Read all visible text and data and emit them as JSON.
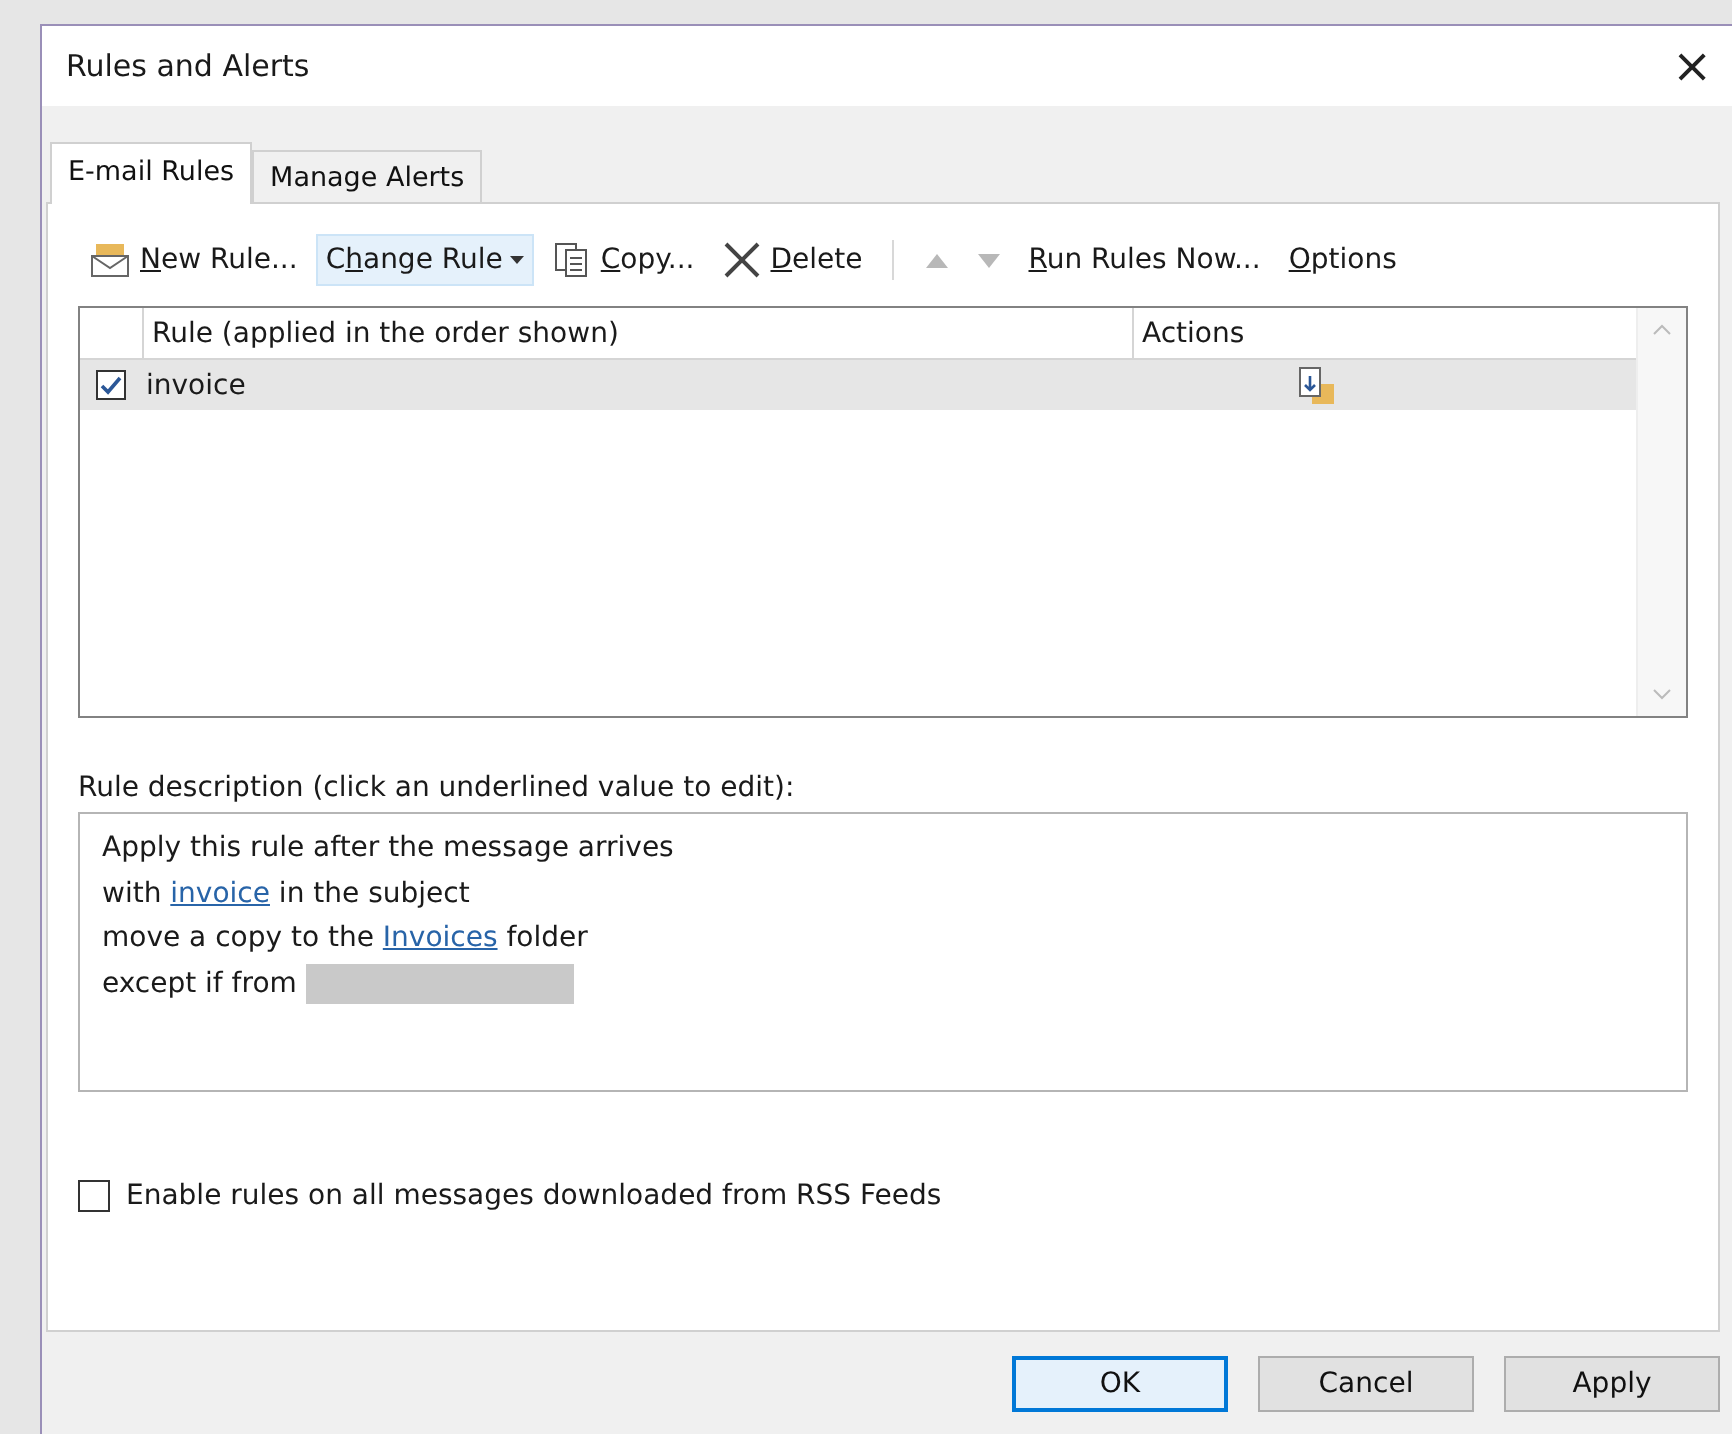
{
  "window": {
    "title": "Rules and Alerts",
    "close": "×"
  },
  "tabs": [
    {
      "label": "E-mail Rules",
      "selected": true
    },
    {
      "label": "Manage Alerts",
      "selected": false
    }
  ],
  "toolbar": [
    {
      "kind": "new",
      "key": "N",
      "post": "ew Rule...",
      "highlighted": false
    },
    {
      "kind": "change",
      "pre": "C",
      "key": "h",
      "post": "ange Rule",
      "dropdown": true,
      "highlighted": true
    },
    {
      "kind": "copy",
      "key": "C",
      "post": "opy...",
      "highlighted": false
    },
    {
      "kind": "delete",
      "key": "D",
      "post": "elete",
      "highlighted": false
    },
    {
      "kind": "separator"
    },
    {
      "kind": "up",
      "disabled": true
    },
    {
      "kind": "down",
      "disabled": true
    },
    {
      "kind": "run",
      "key": "R",
      "post": "un Rules Now...",
      "highlighted": false
    },
    {
      "kind": "options",
      "key": "O",
      "post": "ptions",
      "highlighted": false
    }
  ],
  "table": {
    "columns": [
      "Rule (applied in the order shown)",
      "Actions"
    ],
    "rows": [
      {
        "rule": "invoice",
        "checked": true,
        "selected": true
      }
    ]
  },
  "description": {
    "label": "Rule description (click an underlined value to edit):",
    "lines": [
      [
        {
          "kind": "text",
          "text": "Apply this rule after the message arrives"
        }
      ],
      [
        {
          "kind": "text",
          "text": "with "
        },
        {
          "kind": "link",
          "text": "invoice"
        },
        {
          "kind": "text",
          "text": " in the subject"
        }
      ],
      [
        {
          "kind": "text",
          "text": "move a copy to the "
        },
        {
          "kind": "link",
          "text": "Invoices"
        },
        {
          "kind": "text",
          "text": " folder"
        }
      ],
      [
        {
          "kind": "text",
          "text": "except if from "
        },
        {
          "kind": "redacted"
        }
      ]
    ]
  },
  "rss_option": {
    "label": "Enable rules on all messages downloaded from RSS Feeds",
    "checked": false
  },
  "buttons": [
    {
      "label": "OK",
      "default": true
    },
    {
      "label": "Cancel",
      "default": false
    },
    {
      "label": "Apply",
      "default": false
    }
  ]
}
